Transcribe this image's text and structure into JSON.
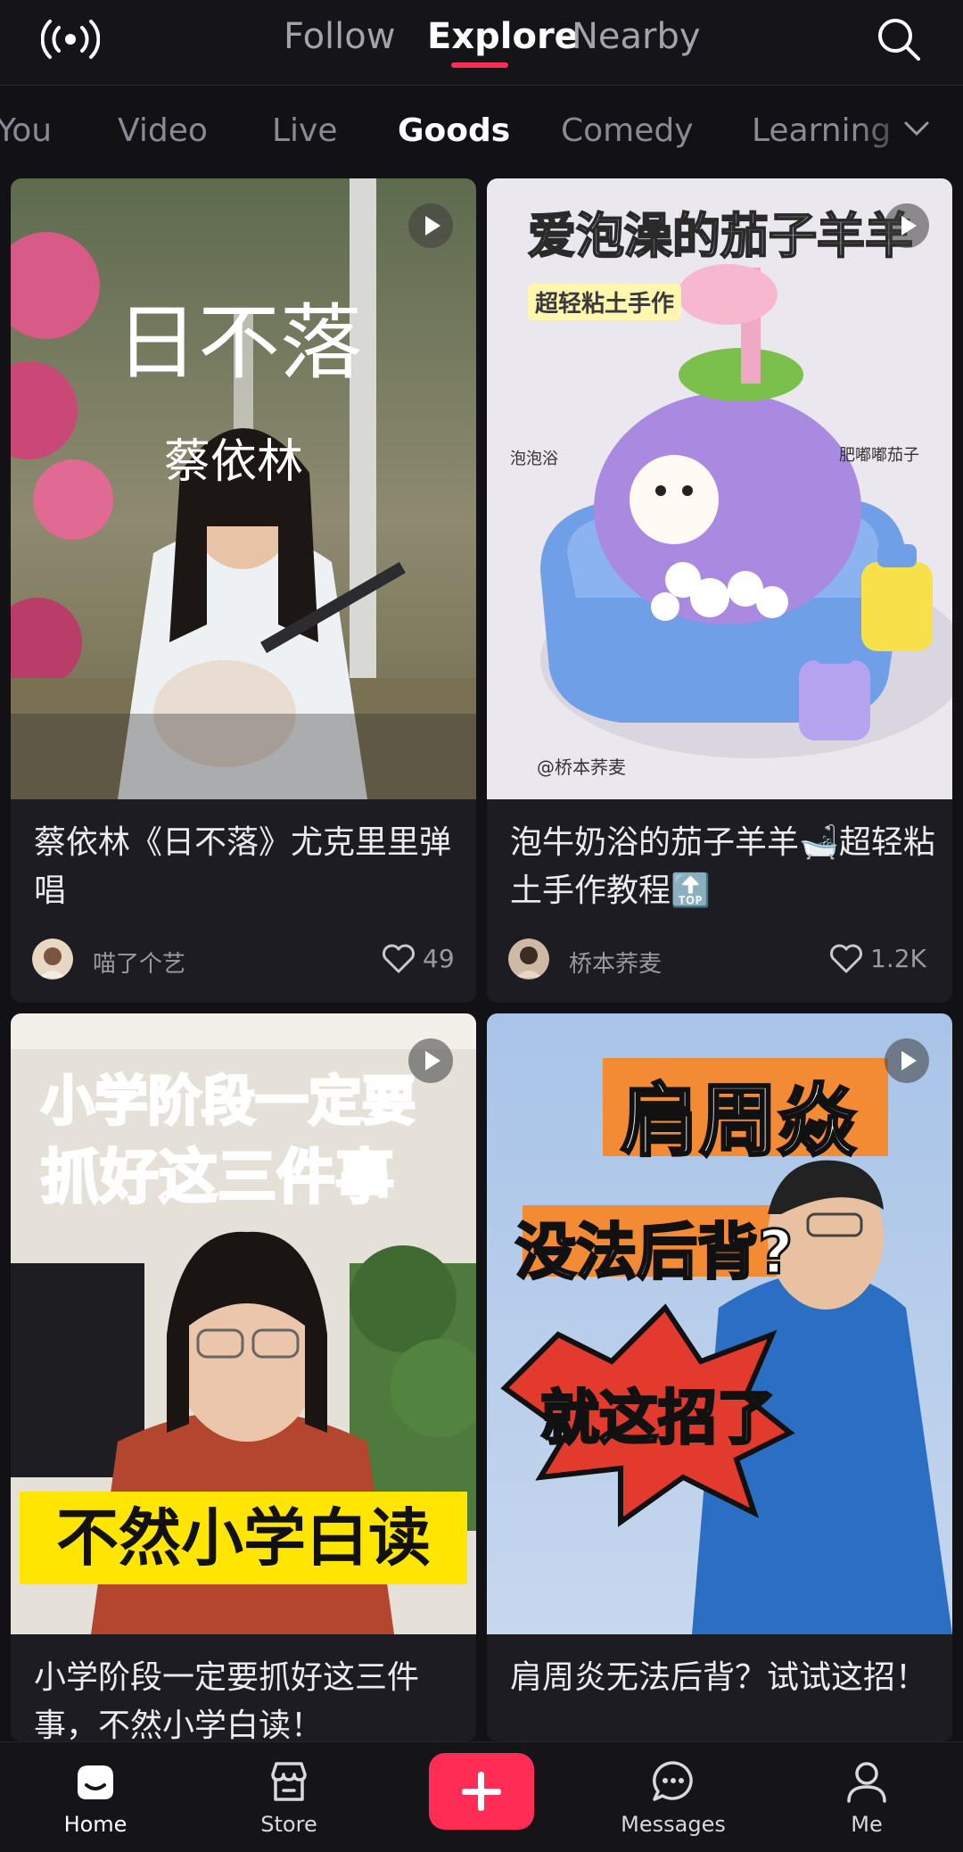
{
  "header": {
    "tabs": [
      "Follow",
      "Explore",
      "Nearby"
    ],
    "active_tab": "Explore"
  },
  "categories": {
    "items": [
      "You",
      "Video",
      "Live",
      "Goods",
      "Comedy",
      "Learning"
    ],
    "active": "Goods"
  },
  "cards": [
    {
      "title": "蔡依林《日不落》尤克里里弹唱",
      "overlay_lines": [
        "日不落",
        "蔡依林"
      ],
      "author": "喵了个艺",
      "likes": "49"
    },
    {
      "title": "泡牛奶浴的茄子羊羊🛁超轻粘土手作教程🔝",
      "overlay_lines": [
        "爱泡澡的茄子羊羊",
        "超轻粘土手作",
        "泡泡浴",
        "肥嘟嘟茄子",
        "@桥本荞麦"
      ],
      "author": "桥本荞麦",
      "likes": "1.2K"
    },
    {
      "title": "小学阶段一定要抓好这三件事，不然小学白读！",
      "overlay_lines": [
        "小学阶段一定要",
        "抓好这三件事",
        "不然小学白读"
      ]
    },
    {
      "title": "肩周炎无法后背？试试这招！",
      "overlay_lines": [
        "肩周焱",
        "没法后背?",
        "就这招了"
      ]
    }
  ],
  "bottom_nav": {
    "home": "Home",
    "store": "Store",
    "messages": "Messages",
    "me": "Me"
  },
  "colors": {
    "accent": "#ff2d55",
    "background": "#111116",
    "card": "#1c1c22"
  }
}
